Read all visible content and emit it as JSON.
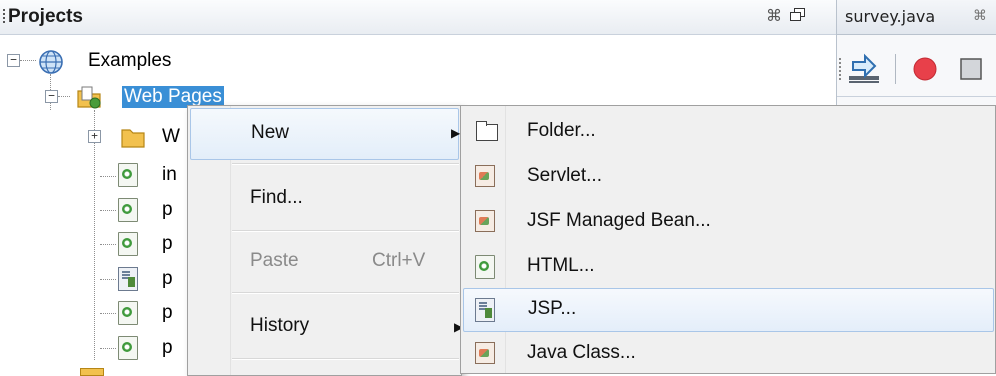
{
  "projects_panel": {
    "title": "Projects",
    "tree": [
      {
        "label": "Examples"
      },
      {
        "label": "Web Pages"
      },
      {
        "label": "W"
      },
      {
        "label": "in"
      },
      {
        "label": "p"
      },
      {
        "label": "p"
      },
      {
        "label": "p"
      },
      {
        "label": "p"
      },
      {
        "label": "p"
      }
    ]
  },
  "editor": {
    "tab_label": "survey.java"
  },
  "context_menu": {
    "items": [
      {
        "label": "New",
        "has_submenu": true
      },
      {
        "label": "Find..."
      },
      {
        "label": "Paste",
        "shortcut": "Ctrl+V",
        "disabled": true
      },
      {
        "label": "History",
        "has_submenu": true
      }
    ]
  },
  "submenu": {
    "items": [
      {
        "label": "Folder...",
        "icon": "folder-icon"
      },
      {
        "label": "Servlet...",
        "icon": "class-icon"
      },
      {
        "label": "JSF Managed Bean...",
        "icon": "class-icon"
      },
      {
        "label": "HTML...",
        "icon": "html-file-icon"
      },
      {
        "label": "JSP...",
        "icon": "jsp-file-icon"
      },
      {
        "label": "Java Class...",
        "icon": "class-icon"
      }
    ]
  },
  "colors": {
    "selection": "#3a8fd6",
    "menu_bg": "#f0f0f0",
    "menu_highlight_border": "#a9c6e8"
  }
}
